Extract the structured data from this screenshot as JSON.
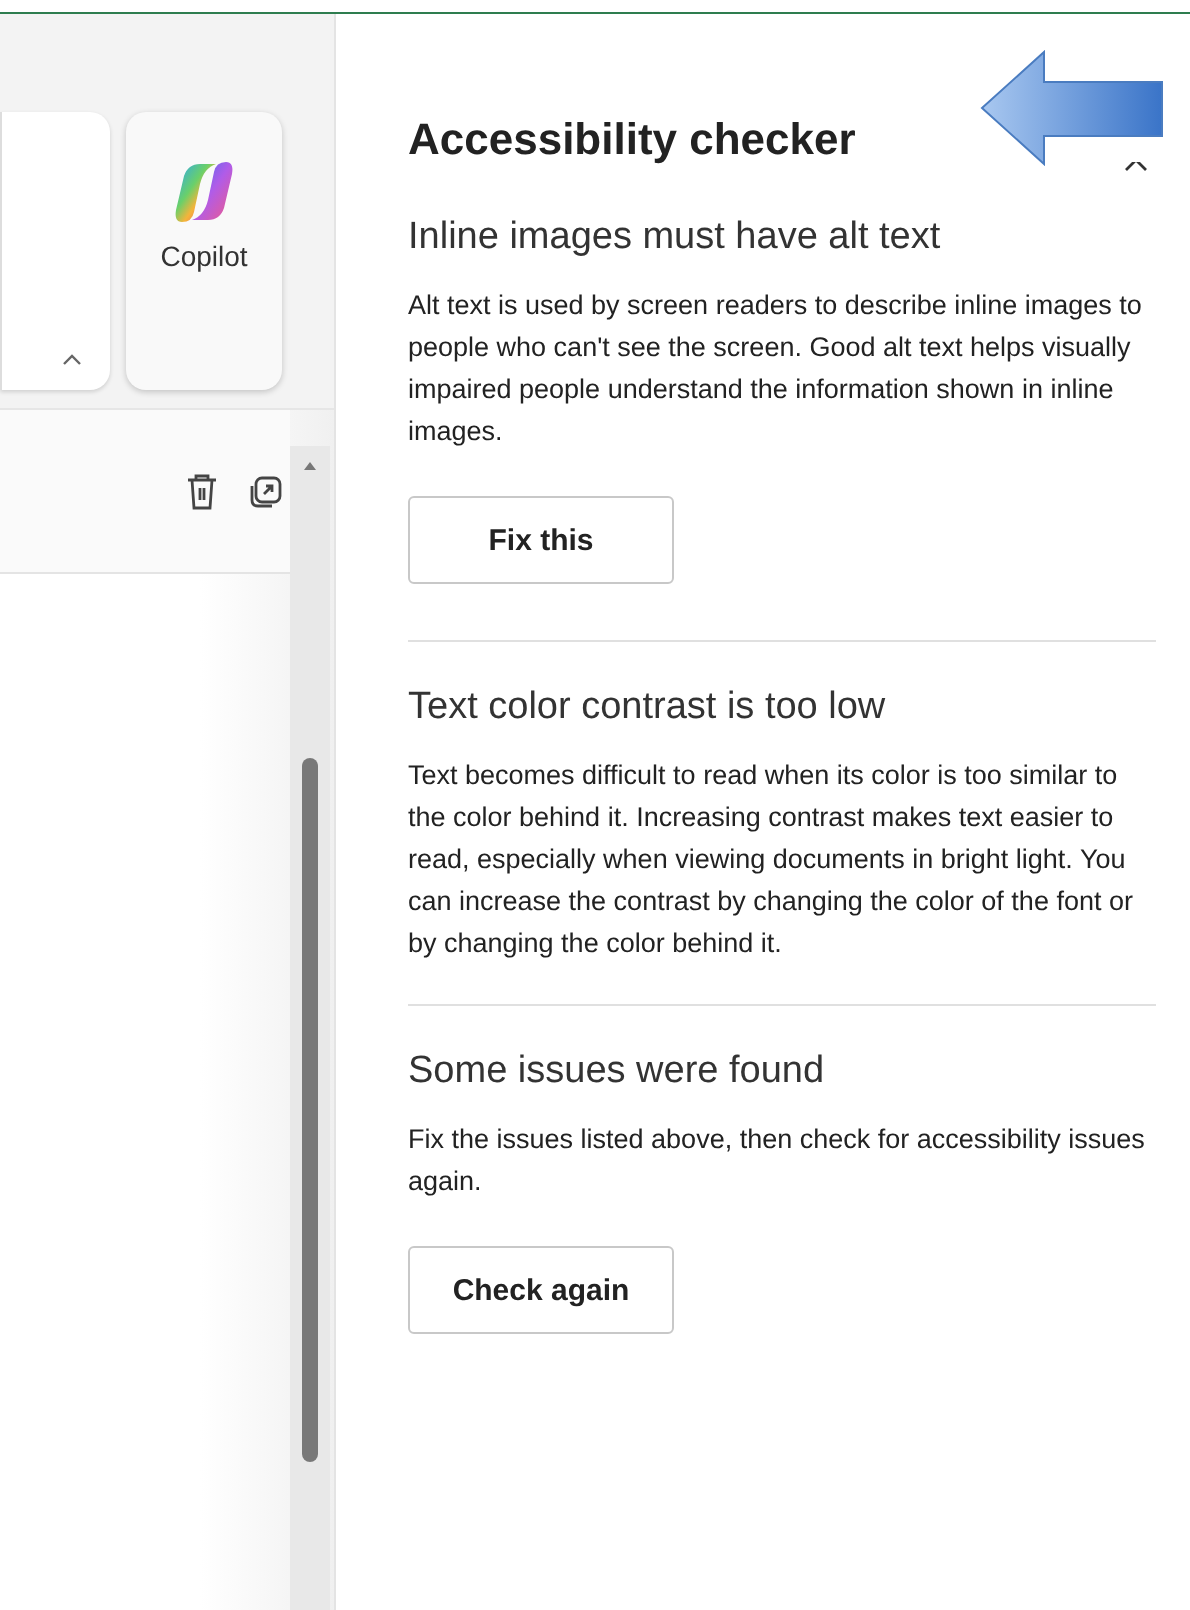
{
  "ribbon": {
    "copilot_label": "Copilot"
  },
  "panel": {
    "title": "Accessibility checker",
    "sections": [
      {
        "heading": "Inline images must have alt text",
        "body": "Alt text is used by screen readers to describe inline images to people who can't see the screen. Good alt text helps visually impaired people understand the information shown in inline images.",
        "button": "Fix this"
      },
      {
        "heading": "Text color contrast is too low",
        "body": "Text becomes difficult to read when its color is too similar to the color behind it. Increasing contrast makes text easier to read, especially when viewing documents in bright light. You can increase the contrast by changing the color of the font or by changing the color behind it."
      },
      {
        "heading": "Some issues were found",
        "body": "Fix the issues listed above, then check for accessibility issues again.",
        "button": "Check again"
      }
    ]
  }
}
